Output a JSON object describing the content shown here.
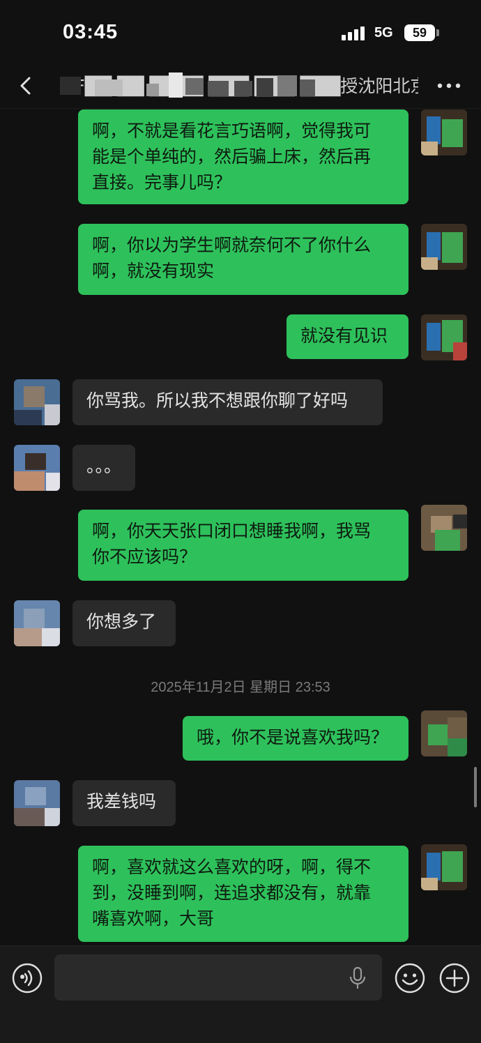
{
  "status_bar": {
    "time": "03:45",
    "network": "5G",
    "battery": "59"
  },
  "nav": {
    "title": "GF██ ██ ████ ███ ███ ███授沈阳北京"
  },
  "messages": [
    {
      "direction": "out",
      "text": "啊，不就是看花言巧语啊，觉得我可\n能是个单纯的，然后骗上床，然后再\n直接。完事儿吗？"
    },
    {
      "direction": "out",
      "text": "啊，你以为学生啊就奈何不了你什么\n啊，就没有现实"
    },
    {
      "direction": "out",
      "text": "就没有见识"
    },
    {
      "direction": "in",
      "text": "你骂我。所以我不想跟你聊了好吗"
    },
    {
      "direction": "in",
      "text": "。。。"
    },
    {
      "direction": "out",
      "text": "啊，你天天张口闭口想睡我啊，我骂\n你不应该吗？"
    },
    {
      "direction": "in",
      "text": "你想多了"
    },
    {
      "direction": "out",
      "text": "哦，你不是说喜欢我吗？"
    },
    {
      "direction": "in",
      "text": "我差钱吗"
    },
    {
      "direction": "out",
      "text": "啊，喜欢就这么喜欢的呀，啊，得不\n到，没睡到啊，连追求都没有，就靠\n嘴喜欢啊，大哥"
    }
  ],
  "time_separator": "2025年11月2日 星期日 23:53",
  "input": {
    "placeholder": ""
  },
  "icons": {
    "back": "chevron-left-icon",
    "more": "more-dots-icon",
    "voice": "voice-icon",
    "mic": "microphone-icon",
    "emoji": "emoji-icon",
    "plus": "plus-icon"
  },
  "colors": {
    "outgoing_bubble": "#2ec15b",
    "incoming_bubble": "#2a2a2a",
    "background": "#111111"
  }
}
